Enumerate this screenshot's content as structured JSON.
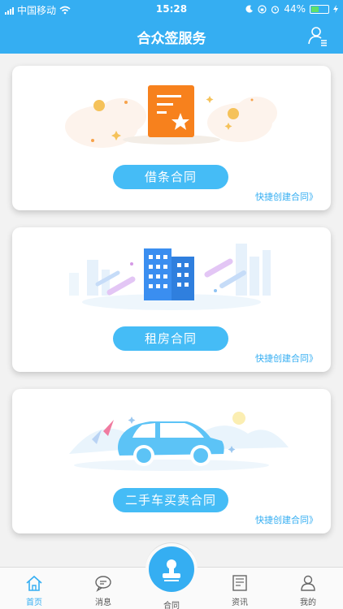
{
  "status": {
    "carrier": "中国移动",
    "time": "15:28",
    "battery": "44%"
  },
  "nav": {
    "title": "合众签服务",
    "user_icon": "user-list-icon"
  },
  "cards": [
    {
      "label": "借条合同",
      "link": "快捷创建合同》",
      "illustration": "document-star-icon"
    },
    {
      "label": "租房合同",
      "link": "快捷创建合同》",
      "illustration": "building-icon"
    },
    {
      "label": "二手车买卖合同",
      "link": "快捷创建合同》",
      "illustration": "car-icon"
    }
  ],
  "tabs": [
    {
      "label": "首页",
      "icon": "home-icon",
      "active": true
    },
    {
      "label": "消息",
      "icon": "message-icon",
      "active": false
    },
    {
      "label": "合同",
      "icon": "stamp-icon",
      "active": false
    },
    {
      "label": "资讯",
      "icon": "news-icon",
      "active": false
    },
    {
      "label": "我的",
      "icon": "person-icon",
      "active": false
    }
  ],
  "colors": {
    "primary": "#35aef2",
    "button": "#45bcf6",
    "orange": "#f7811d"
  }
}
